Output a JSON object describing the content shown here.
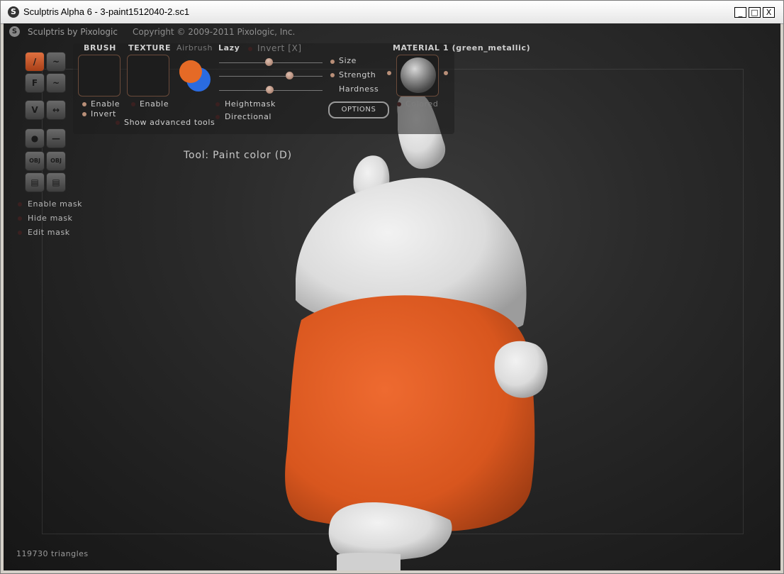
{
  "window": {
    "title": "Sculptris Alpha 6 - 3-paint1512040-2.sc1",
    "app_icon": "sculptris-logo-icon",
    "minimize_glyph": "_",
    "maximize_glyph": "□",
    "close_glyph": "X"
  },
  "header": {
    "app_name": "Sculptris by Pixologic",
    "copyright": "Copyright © 2009-2011 Pixologic, Inc."
  },
  "toolbar": {
    "brush_label": "BRUSH",
    "texture_label": "TEXTURE",
    "airbrush_label": "Airbrush",
    "lazy_label": "Lazy",
    "invert_x_label": "Invert [X]",
    "brush_enable": "Enable",
    "brush_invert": "Invert",
    "texture_enable": "Enable",
    "show_advanced": "Show advanced tools",
    "heightmask": "Heightmask",
    "directional": "Directional",
    "size_label": "Size",
    "strength_label": "Strength",
    "hardness_label": "Hardness",
    "size_value": 0.5,
    "strength_value": 0.7,
    "hardness_value": 0.5,
    "options_button": "OPTIONS",
    "material_label": "MATERIAL 1 (green_metallic)",
    "colored_label": "Colored",
    "primary_color": "#e56a26",
    "secondary_color": "#2a6be0"
  },
  "tools": {
    "btn_f": "F",
    "btn_obj1": "OBJ",
    "btn_obj2": "OBJ"
  },
  "mask": {
    "enable": "Enable mask",
    "hide": "Hide mask",
    "edit": "Edit mask"
  },
  "status": {
    "tool": "Tool: Paint color (D)",
    "triangles": "119730 triangles"
  },
  "colors": {
    "paint": "#e05a24",
    "model": "#e8e8e8"
  }
}
